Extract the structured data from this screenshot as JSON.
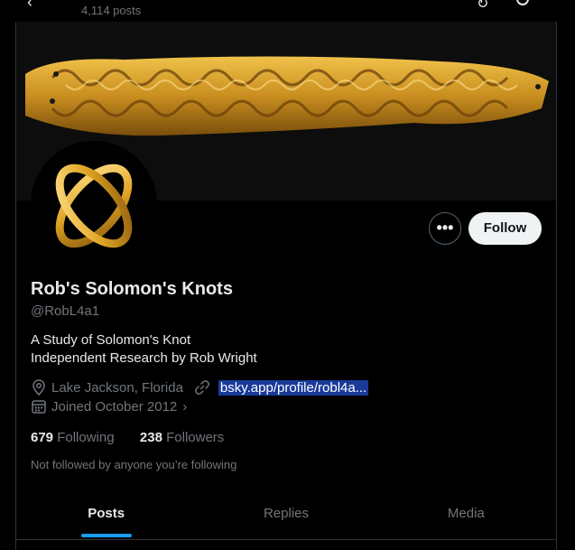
{
  "header": {
    "post_count": "4,114 posts"
  },
  "profile": {
    "display_name": "Rob's Solomon's Knots",
    "handle": "@RobL4a1",
    "bio_line1": "A Study of Solomon's Knot",
    "bio_line2": "Independent Research by Rob Wright",
    "location": "Lake Jackson, Florida",
    "website": "bsky.app/profile/robl4a...",
    "joined": "Joined October 2012",
    "following_count": "679",
    "following_label": "Following",
    "followers_count": "238",
    "followers_label": "Followers",
    "not_followed_note": "Not followed by anyone you’re following"
  },
  "actions": {
    "more_label": "•••",
    "follow_label": "Follow"
  },
  "tabs": [
    {
      "label": "Posts"
    },
    {
      "label": "Replies"
    },
    {
      "label": "Media"
    }
  ],
  "colors": {
    "accent": "#1d9bf0",
    "background": "#000000",
    "link_highlight": "#1a3a9a"
  }
}
